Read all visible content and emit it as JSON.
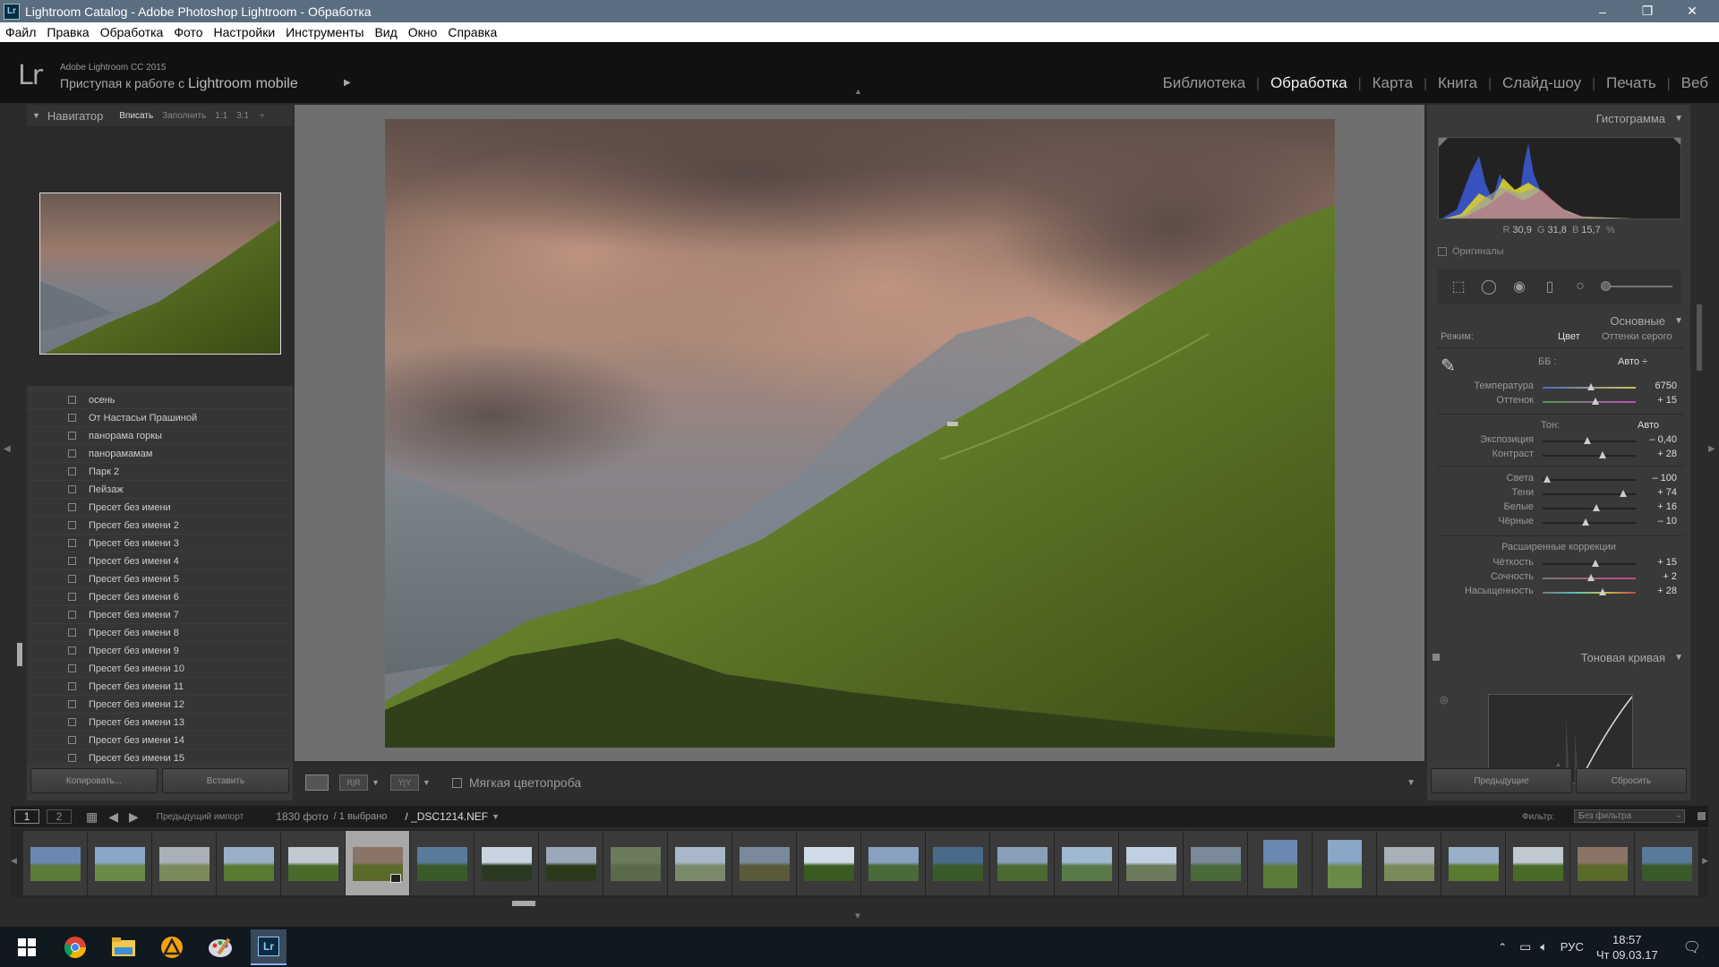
{
  "window": {
    "title": "Lightroom Catalog - Adobe Photoshop Lightroom - Обработка",
    "app_icon": "Lr",
    "minimize": "–",
    "maximize": "❐",
    "close": "✕"
  },
  "menu": [
    "Файл",
    "Правка",
    "Обработка",
    "Фото",
    "Настройки",
    "Инструменты",
    "Вид",
    "Окно",
    "Справка"
  ],
  "identity": {
    "logo": "Lr",
    "product": "Adobe Lightroom CC 2015",
    "mobile_prefix": "Приступая к работе с",
    "mobile_name": "Lightroom mobile"
  },
  "modules": [
    "Библиотека",
    "Обработка",
    "Карта",
    "Книга",
    "Слайд-шоу",
    "Печать",
    "Веб"
  ],
  "active_module": "Обработка",
  "navigator": {
    "title": "Навигатор",
    "zoom": [
      "Вписать",
      "Заполнить",
      "1:1",
      "3:1"
    ],
    "zoom_selected": "Вписать"
  },
  "presets": [
    "осень",
    "От Настасьи Прашиной",
    "панорама горкы",
    "панорамамам",
    "Парк 2",
    "Пейзаж",
    "Пресет без имени",
    "Пресет без имени 2",
    "Пресет без имени 3",
    "Пресет без имени 4",
    "Пресет без имени 5",
    "Пресет без имени 6",
    "Пресет без имени 7",
    "Пресет без имени 8",
    "Пресет без имени 9",
    "Пресет без имени 10",
    "Пресет без имени 11",
    "Пресет без имени 12",
    "Пресет без имени 13",
    "Пресет без имени 14",
    "Пресет без имени 15"
  ],
  "left_buttons": {
    "copy": "Копировать...",
    "paste": "Вставить"
  },
  "toolbar": {
    "soft_proof": "Мягкая цветопроба"
  },
  "histogram": {
    "title": "Гистограмма",
    "r_label": "R",
    "r": "30,9",
    "g_label": "G",
    "g": "31,8",
    "b_label": "B",
    "b": "15,7",
    "unit": "%",
    "originals": "Оригиналы"
  },
  "basic": {
    "title": "Основные",
    "mode_label": "Режим:",
    "mode_color": "Цвет",
    "mode_bw": "Оттенки серого",
    "wb_label": "ББ :",
    "wb_value": "Авто ÷",
    "tone_label": "Тон:",
    "tone_auto": "Авто",
    "presence_label": "Расширенные коррекции",
    "sliders": [
      {
        "key": "temp",
        "label": "Температура",
        "value": "6750",
        "pos": 0.52
      },
      {
        "key": "tint",
        "label": "Оттенок",
        "value": "+ 15",
        "pos": 0.57
      },
      {
        "key": "exposure",
        "label": "Экспозиция",
        "value": "– 0,40",
        "pos": 0.48
      },
      {
        "key": "contrast",
        "label": "Контраст",
        "value": "+ 28",
        "pos": 0.64
      },
      {
        "key": "highlights",
        "label": "Света",
        "value": "– 100",
        "pos": 0.05
      },
      {
        "key": "shadows",
        "label": "Тени",
        "value": "+ 74",
        "pos": 0.87
      },
      {
        "key": "whites",
        "label": "Белые",
        "value": "+ 16",
        "pos": 0.58
      },
      {
        "key": "blacks",
        "label": "Чёрные",
        "value": "– 10",
        "pos": 0.46
      },
      {
        "key": "clarity",
        "label": "Чёткость",
        "value": "+ 15",
        "pos": 0.57
      },
      {
        "key": "vibrance",
        "label": "Сочность",
        "value": "+ 2",
        "pos": 0.52
      },
      {
        "key": "saturation",
        "label": "Насыщенность",
        "value": "+ 28",
        "pos": 0.64
      }
    ]
  },
  "tone_curve": {
    "title": "Тоновая кривая"
  },
  "right_buttons": {
    "previous": "Предыдущие",
    "reset": "Сбросить"
  },
  "filmbar": {
    "page1": "1",
    "page2": "2",
    "source": "Предыдущий импорт",
    "count": "1830 фото",
    "selected": "/ 1 выбрано",
    "filename": "/ _DSC1214.NEF",
    "filter_label": "Фильтр:",
    "filter_value": "Без фильтра"
  },
  "taskbar": {
    "lang": "РУС",
    "time": "18:57",
    "date": "Чт 09.03.17"
  },
  "colors": {
    "accent": "#5b6e80",
    "panel": "#393939",
    "background": "#6f6f6f"
  }
}
